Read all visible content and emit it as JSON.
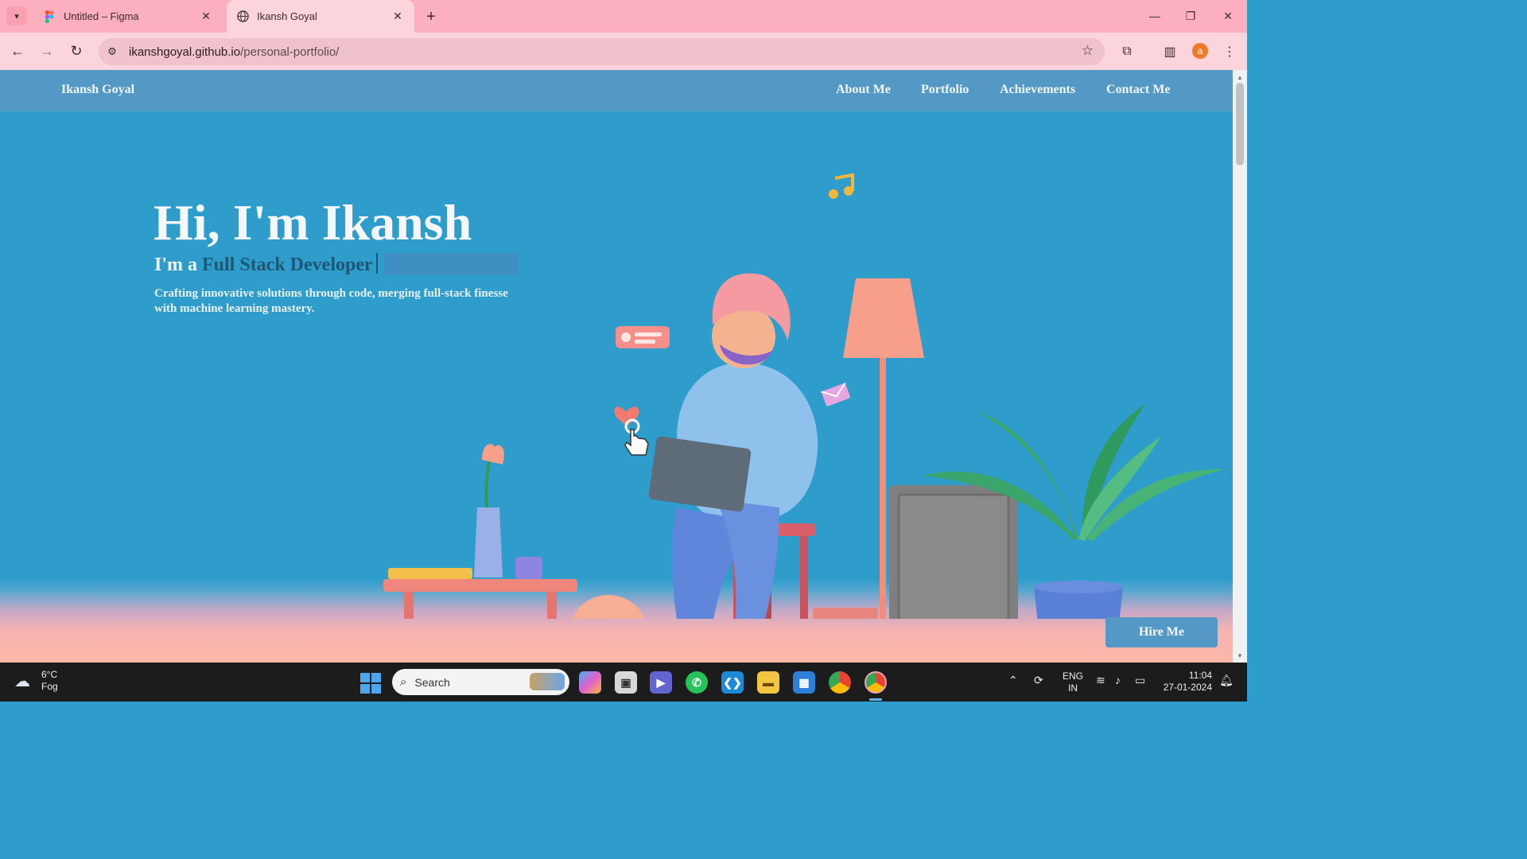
{
  "browser": {
    "tabs": [
      {
        "title": "Untitled – Figma",
        "active": false,
        "favicon": "figma-icon"
      },
      {
        "title": "Ikansh Goyal",
        "active": true,
        "favicon": "globe-icon"
      }
    ],
    "url_host": "ikanshgoyal.github.io",
    "url_path": "/personal-portfolio/",
    "profile_initial": "a",
    "colors": {
      "frame": "#fcb0bf",
      "toolbar": "#fbd4dc",
      "omnibox": "#f0c3cc"
    }
  },
  "site": {
    "brand": "Ikansh Goyal",
    "nav": [
      "About Me",
      "Portfolio",
      "Achievements",
      "Contact Me"
    ],
    "hero": {
      "title": "Hi, I'm Ikansh",
      "subtitle_prefix": "I'm a",
      "subtitle_typed": "Full Stack Developer",
      "description": "Crafting innovative solutions through code, merging full-stack finesse with machine learning mastery."
    },
    "cta": "Hire Me",
    "colors": {
      "background": "#2e9dcb",
      "navbar": "#5499c6",
      "typed_text": "#1e5775"
    }
  },
  "taskbar": {
    "weather": {
      "temp": "6°C",
      "condition": "Fog"
    },
    "search_placeholder": "Search",
    "language": [
      "ENG",
      "IN"
    ],
    "time": "11:04",
    "date": "27-01-2024"
  }
}
